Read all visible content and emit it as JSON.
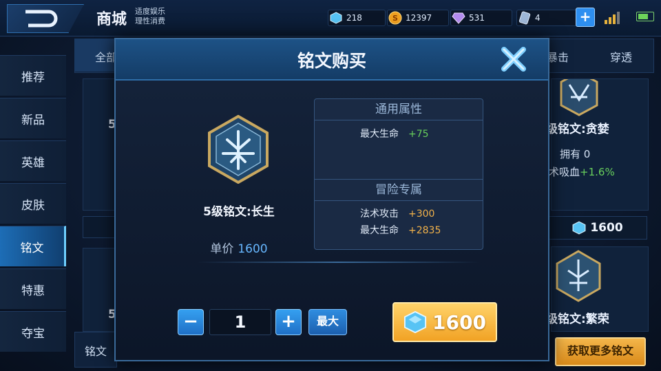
{
  "header": {
    "title": "商城",
    "subtitle_line1": "适度娱乐",
    "subtitle_line2": "理性消费",
    "resources": {
      "crystal": "218",
      "gold": "12397",
      "diamond": "531",
      "voucher": "4"
    }
  },
  "sidebar": {
    "items": [
      {
        "label": "推荐"
      },
      {
        "label": "新品"
      },
      {
        "label": "英雄"
      },
      {
        "label": "皮肤"
      },
      {
        "label": "铭文"
      },
      {
        "label": "特惠"
      },
      {
        "label": "夺宝"
      }
    ],
    "active_index": 4
  },
  "categories": {
    "first": "全部",
    "crit": "暴击",
    "penetrate": "穿透"
  },
  "background": {
    "card1_name": "级铭文:贪婪",
    "card1_own": "拥有 0",
    "card1_stat_label": "术吸血",
    "card1_stat_value": "+1.6%",
    "card1_price": "1600",
    "card2_name": "级铭文:繁荣",
    "left_level": "5",
    "left_level_2": "5",
    "bottom_tab": "铭文",
    "more_button": "获取更多铭文"
  },
  "modal": {
    "title": "铭文购买",
    "rune_name": "5级铭文:长生",
    "unit_price_label": "单价",
    "unit_price_value": "1600",
    "common_attr_title": "通用属性",
    "common_attrs": [
      {
        "name": "最大生命",
        "value": "+75"
      }
    ],
    "adventure_title": "冒险专属",
    "adventure_attrs": [
      {
        "name": "法术攻击",
        "value": "+300"
      },
      {
        "name": "最大生命",
        "value": "+2835"
      }
    ],
    "quantity": "1",
    "max_label": "最大",
    "buy_price": "1600"
  },
  "colors": {
    "accent_blue": "#2e8ff0",
    "gold_button": "#f1a224",
    "stat_green": "#68cf5b",
    "stat_orange": "#f2b24a"
  }
}
